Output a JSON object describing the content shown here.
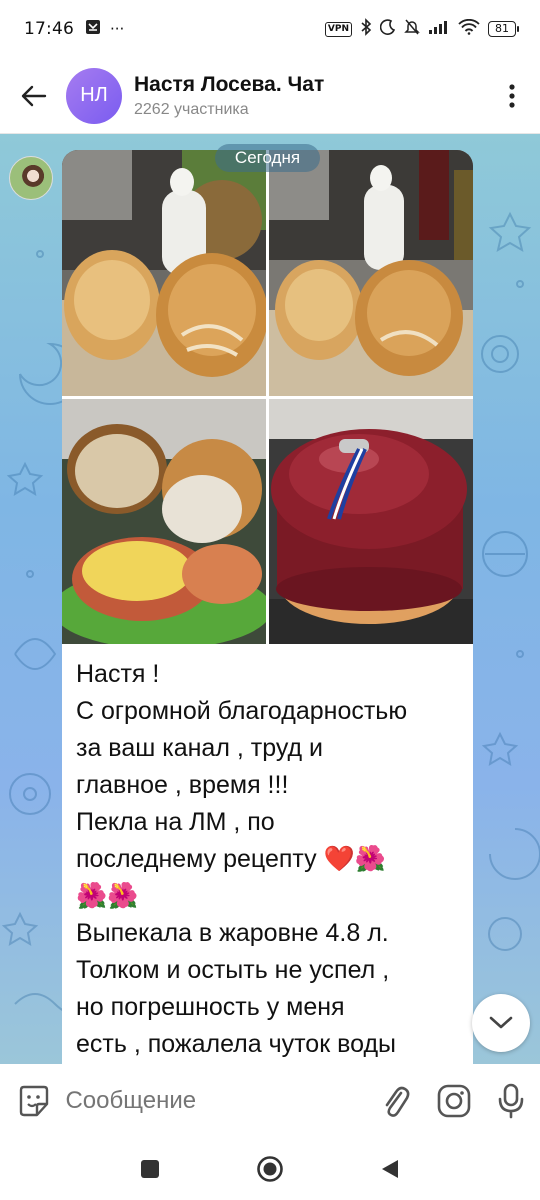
{
  "status_bar": {
    "time": "17:46",
    "left_icons": [
      "notification-icon",
      "more-dots"
    ],
    "more_label": "···",
    "vpn_label": "VPN",
    "battery": "81"
  },
  "header": {
    "avatar_initials": "НЛ",
    "title": "Настя Лосева. Чат",
    "subtitle": "2262 участника"
  },
  "chat": {
    "date_label": "Сегодня",
    "message": {
      "photos": [
        "bread-loaves-photo",
        "bread-loaves-photo-2",
        "bread-slices-sandwich-photo",
        "red-dutch-oven-photo"
      ],
      "lines": [
        "Настя !",
        "С огромной благодарностью",
        "за ваш канал , труд и",
        "главное , время !!!",
        "Пекла на ЛМ , по",
        "последнему рецепту ❤️🌺",
        "🌺🌺",
        "Выпекала в жаровне 4.8 л.",
        "Толком и остыть не успел ,",
        "но погрешность у меня",
        "есть , пожалела чуток воды",
        "))))😊"
      ]
    }
  },
  "input": {
    "placeholder": "Сообщение"
  },
  "colors": {
    "accent": "#8a6cf0",
    "chat_bg": "#8ab9e2",
    "icon": "#555555"
  }
}
